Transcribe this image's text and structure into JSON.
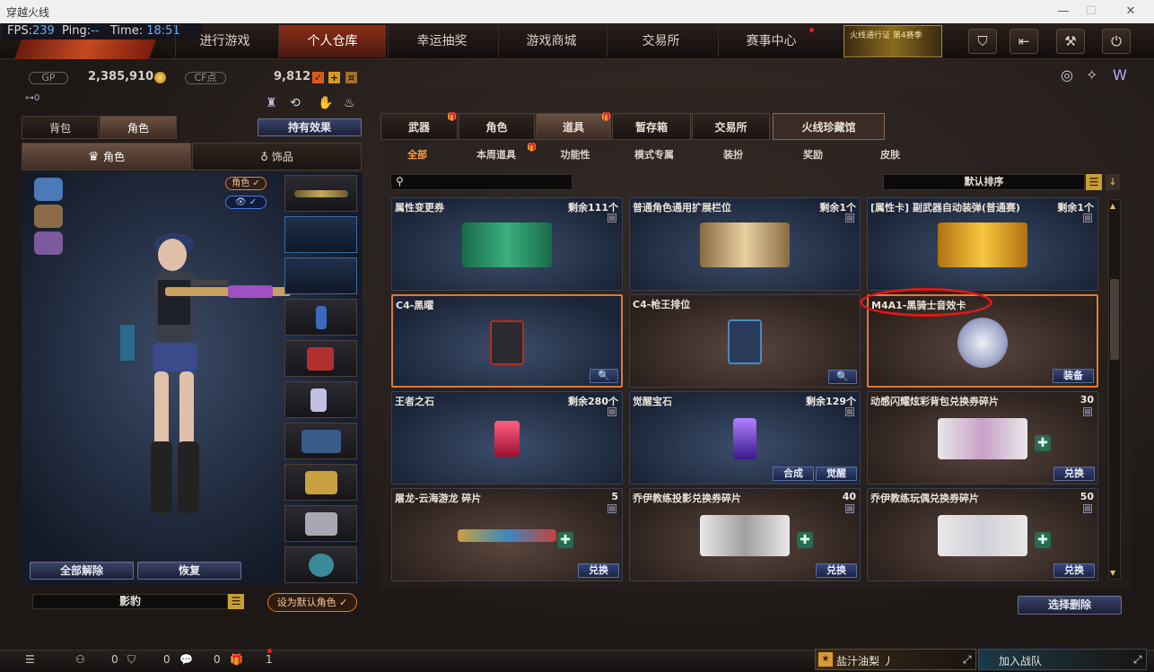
{
  "window": {
    "title": "穿越火线"
  },
  "overlay": {
    "fps_label": "FPS:",
    "fps_value": "239",
    "ping_label": "Ping:",
    "ping_value": "--",
    "time_label": "Time:",
    "time_value": "18:51"
  },
  "nav": {
    "tabs": [
      "进行游戏",
      "个人仓库",
      "幸运抽奖",
      "游戏商城",
      "交易所",
      "赛事中心"
    ],
    "active": "个人仓库",
    "banner": "火线通行证 第4赛季"
  },
  "currency": {
    "gp_label": "GP",
    "gp_value": "2,385,910",
    "cf_label": "CF点",
    "cf_value": "9,812",
    "key_count": "0"
  },
  "left": {
    "tabs": [
      "背包",
      "角色"
    ],
    "effects_button": "持有效果",
    "subtabs": [
      "角色",
      "饰品"
    ],
    "tags": [
      "角色"
    ],
    "unequip_all": "全部解除",
    "restore": "恢复",
    "character_name": "影豹",
    "set_default": "设为默认角色"
  },
  "right": {
    "tabs": [
      "武器",
      "角色",
      "道具",
      "暂存箱",
      "交易所",
      "火线珍藏馆"
    ],
    "active_tab": "道具",
    "subtabs": [
      "全部",
      "本周道具",
      "功能性",
      "模式专属",
      "装扮",
      "奖励",
      "皮肤"
    ],
    "active_subtab": "全部",
    "sort_label": "默认排序",
    "delete_button": "选择删除",
    "cards": [
      {
        "name": "属性变更券",
        "qty": "剩余111个",
        "style": "blue",
        "img": "ticket-green"
      },
      {
        "name": "普通角色通用扩展栏位",
        "qty": "剩余1个",
        "style": "blue",
        "img": "ticket-key"
      },
      {
        "name": "[属性卡] 副武器自动装弹(普通赛)",
        "qty": "剩余1个",
        "style": "blue",
        "img": "ticket-gold"
      },
      {
        "name": "C4-黑曜",
        "qty": "",
        "style": "blue",
        "img": "c4-dark",
        "button": "🔍",
        "selected": true
      },
      {
        "name": "C4-枪王排位",
        "qty": "",
        "style": "brown",
        "img": "c4-blue",
        "button": "🔍"
      },
      {
        "name": "M4A1-黑骑士音效卡",
        "qty": "",
        "style": "brown",
        "img": "disc",
        "button": "装备",
        "selected": true
      },
      {
        "name": "王者之石",
        "qty": "剩余280个",
        "style": "blue",
        "img": "gem-red"
      },
      {
        "name": "觉醒宝石",
        "qty": "剩余129个",
        "style": "blue",
        "img": "gem-purple",
        "buttons": [
          "合成",
          "觉醒"
        ]
      },
      {
        "name": "动感闪耀炫彩背包兑换券碎片",
        "qty": "30",
        "style": "brown",
        "img": "coupon-bag",
        "button": "兑换"
      },
      {
        "name": "屠龙-云海游龙 碎片",
        "qty": "5",
        "style": "brown",
        "img": "knife",
        "button": "兑换"
      },
      {
        "name": "乔伊教练投影兑换券碎片",
        "qty": "40",
        "style": "brown",
        "img": "coupon-proj",
        "button": "兑换"
      },
      {
        "name": "乔伊教练玩偶兑换券碎片",
        "qty": "50",
        "style": "brown",
        "img": "coupon-doll",
        "button": "兑换"
      }
    ]
  },
  "bottom": {
    "c1": "0",
    "c2": "0",
    "c3": "0",
    "c4": "1",
    "player": "盐汁油梨 丿",
    "join_team": "加入战队"
  }
}
